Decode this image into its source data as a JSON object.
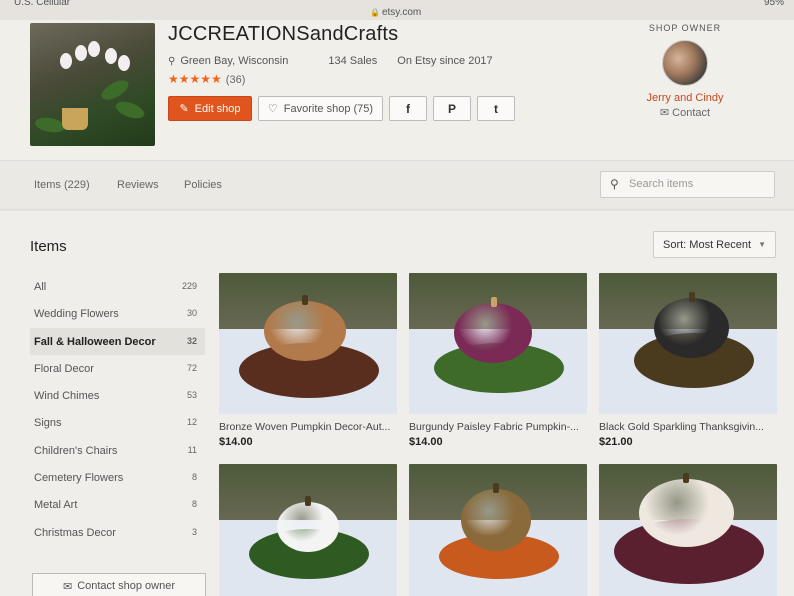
{
  "statusbar": {
    "carrier": "U.S. Cellular",
    "url": "etsy.com",
    "battery": "95%"
  },
  "shop": {
    "name": "JCCREATIONSandCrafts",
    "location": "Green Bay, Wisconsin",
    "sales": "134 Sales",
    "since": "On Etsy since 2017",
    "stars": "★★★★★",
    "reviews_count": "(36)",
    "edit_label": "Edit shop",
    "favorite_label": "Favorite shop (75)",
    "social": {
      "facebook": "f",
      "pinterest": "P",
      "twitter": "t"
    }
  },
  "owner": {
    "title": "SHOP OWNER",
    "name": "Jerry and Cindy",
    "contact_label": "Contact"
  },
  "tabs": [
    {
      "label": "Items (229)"
    },
    {
      "label": "Reviews"
    },
    {
      "label": "Policies"
    }
  ],
  "search": {
    "placeholder": "Search items"
  },
  "items_heading": "Items",
  "sort_label": "Sort: Most Recent",
  "categories": [
    {
      "name": "All",
      "count": "229"
    },
    {
      "name": "Wedding Flowers",
      "count": "30"
    },
    {
      "name": "Fall & Halloween Decor",
      "count": "32"
    },
    {
      "name": "Floral Decor",
      "count": "72"
    },
    {
      "name": "Wind Chimes",
      "count": "53"
    },
    {
      "name": "Signs",
      "count": "12"
    },
    {
      "name": "Children's Chairs",
      "count": "11"
    },
    {
      "name": "Cemetery Flowers",
      "count": "8"
    },
    {
      "name": "Metal Art",
      "count": "8"
    },
    {
      "name": "Christmas Decor",
      "count": "3"
    }
  ],
  "contact_shop_label": "Contact shop owner",
  "products": [
    {
      "title": "Bronze Woven Pumpkin Decor-Aut...",
      "price": "$14.00",
      "color": "#b27a4a"
    },
    {
      "title": "Burgundy Paisley Fabric Pumpkin-...",
      "price": "$14.00",
      "color": "#7a2a55"
    },
    {
      "title": "Black Gold Sparkling Thanksgivin...",
      "price": "$21.00",
      "color": "#2a2a2a"
    },
    {
      "title": "",
      "price": "",
      "color": "#f4f4f4"
    },
    {
      "title": "",
      "price": "",
      "color": "#8a6a3a"
    },
    {
      "title": "",
      "price": "",
      "color": "#efe8e0"
    }
  ],
  "colors": {
    "accent": "#e0541d",
    "owner_name": "#c24a22",
    "stars": "#f1641e"
  }
}
